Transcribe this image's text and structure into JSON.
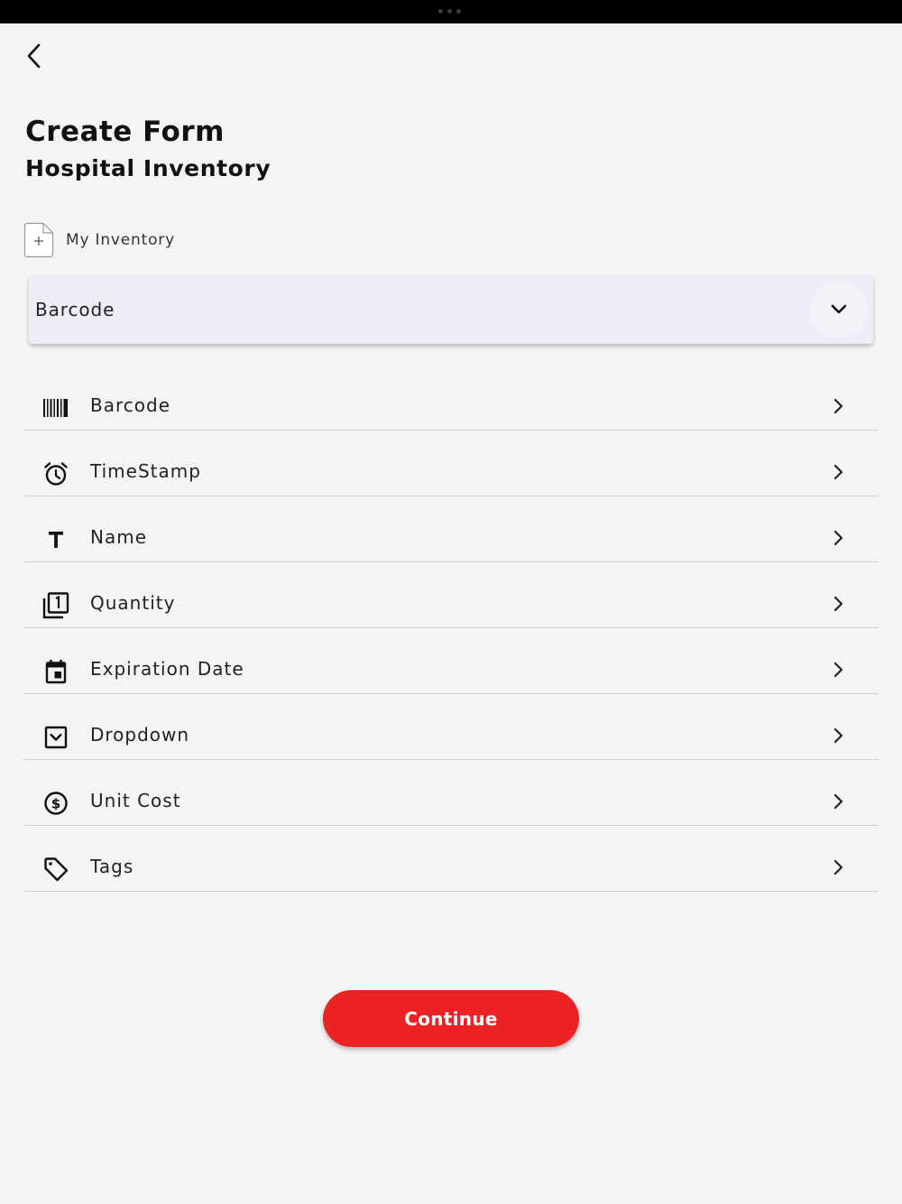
{
  "header": {
    "title": "Create Form",
    "subtitle": "Hospital Inventory"
  },
  "inventory": {
    "label": "My Inventory",
    "icon": "add-document-icon"
  },
  "type_select": {
    "value": "Barcode",
    "icon": "chevron-down-icon"
  },
  "fields": [
    {
      "label": "Barcode",
      "icon": "barcode-icon"
    },
    {
      "label": "TimeStamp",
      "icon": "alarm-clock-icon"
    },
    {
      "label": "Name",
      "icon": "text-icon"
    },
    {
      "label": "Quantity",
      "icon": "number-box-icon"
    },
    {
      "label": "Expiration Date",
      "icon": "calendar-icon"
    },
    {
      "label": "Dropdown",
      "icon": "dropdown-box-icon"
    },
    {
      "label": "Unit Cost",
      "icon": "dollar-circle-icon"
    },
    {
      "label": "Tags",
      "icon": "tag-icon"
    }
  ],
  "continue_label": "Continue",
  "colors": {
    "accent": "#ec2224",
    "select_background": "#efecf7",
    "page_background": "#f4f4f4"
  }
}
